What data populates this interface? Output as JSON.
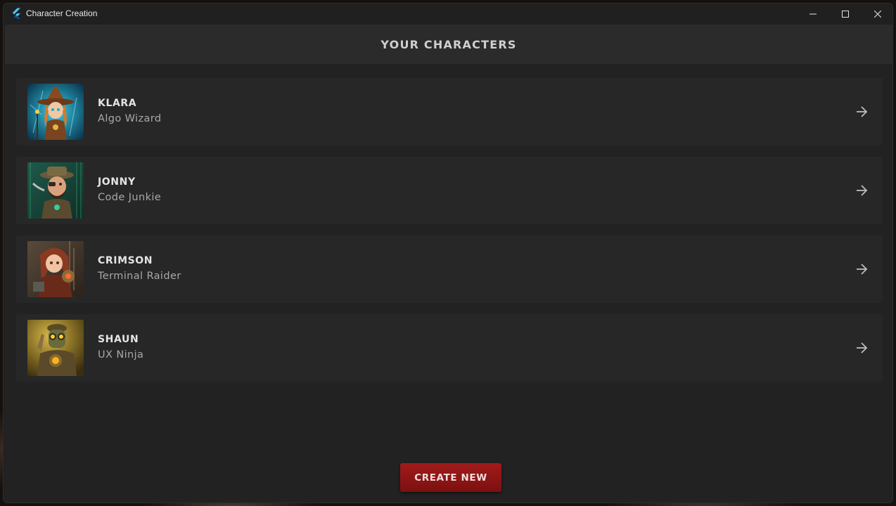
{
  "window": {
    "title": "Character Creation",
    "icon": "flutter-logo-icon",
    "controls": [
      "minimize-icon",
      "maximize-icon",
      "close-icon"
    ]
  },
  "header": {
    "title": "YOUR CHARACTERS"
  },
  "characters": [
    {
      "name": "KLARA",
      "role": "Algo Wizard",
      "avatar": "klara-portrait",
      "action_icon": "arrow-right-icon"
    },
    {
      "name": "JONNY",
      "role": "Code Junkie",
      "avatar": "jonny-portrait",
      "action_icon": "arrow-right-icon"
    },
    {
      "name": "CRIMSON",
      "role": "Terminal Raider",
      "avatar": "crimson-portrait",
      "action_icon": "arrow-right-icon"
    },
    {
      "name": "SHAUN",
      "role": "UX Ninja",
      "avatar": "shaun-portrait",
      "action_icon": "arrow-right-icon"
    }
  ],
  "actions": {
    "create_label": "CREATE NEW"
  },
  "colors": {
    "accent": "#9a1717",
    "background": "#222222",
    "row": "#272727",
    "header": "#2b2b2b"
  }
}
